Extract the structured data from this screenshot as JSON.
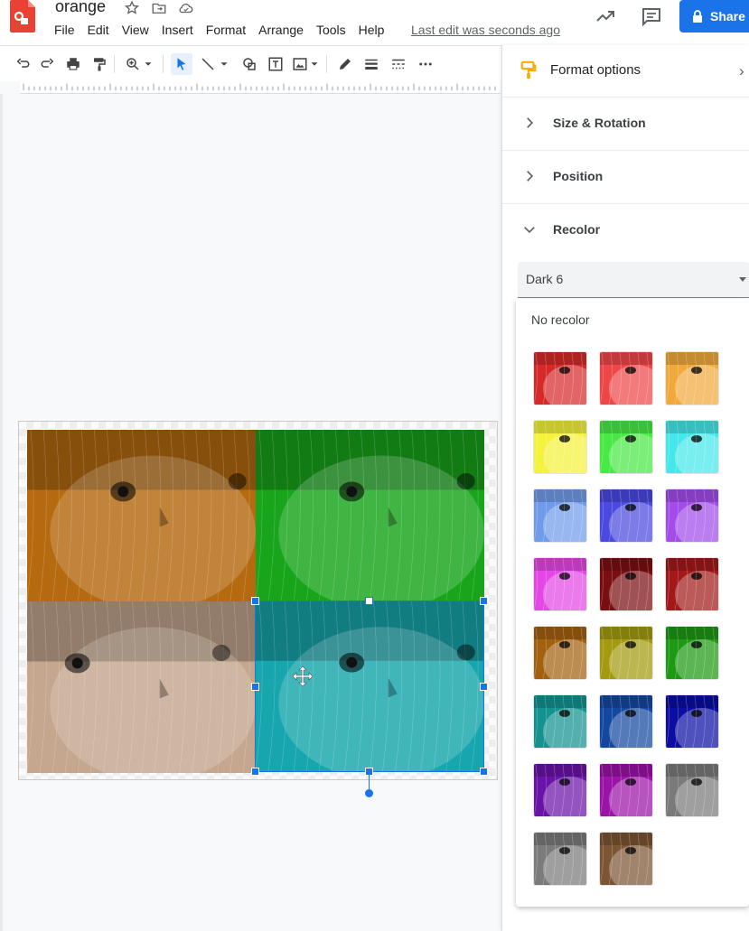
{
  "header": {
    "doc_title": "orange",
    "menu": [
      "File",
      "Edit",
      "View",
      "Insert",
      "Format",
      "Arrange",
      "Tools",
      "Help"
    ],
    "last_edit": "Last edit was seconds ago",
    "share_label": "Share"
  },
  "canvas": {
    "quadrant_tints": [
      "#b56a10",
      "#18a51b",
      "#c4a78e",
      "#17a6ad"
    ]
  },
  "panel": {
    "title": "Format options",
    "sections": [
      "Size & Rotation",
      "Position",
      "Recolor"
    ],
    "recolor_value": "Dark 6"
  },
  "recolor_menu": {
    "no_recolor": "No recolor",
    "swatches": [
      "#d62a2a",
      "#ef4747",
      "#f2a93c",
      "#f4f23a",
      "#48e845",
      "#45e8ea",
      "#6f9bea",
      "#4a49e0",
      "#a34cea",
      "#e447e6",
      "#7a0f12",
      "#a3191a",
      "#a3600f",
      "#a39a0f",
      "#1e9914",
      "#13928f",
      "#1447a0",
      "#0c0ea3",
      "#6a13a8",
      "#9c13a8",
      "#7a7a7a",
      "#7b7b7b",
      "#7c5532"
    ]
  }
}
